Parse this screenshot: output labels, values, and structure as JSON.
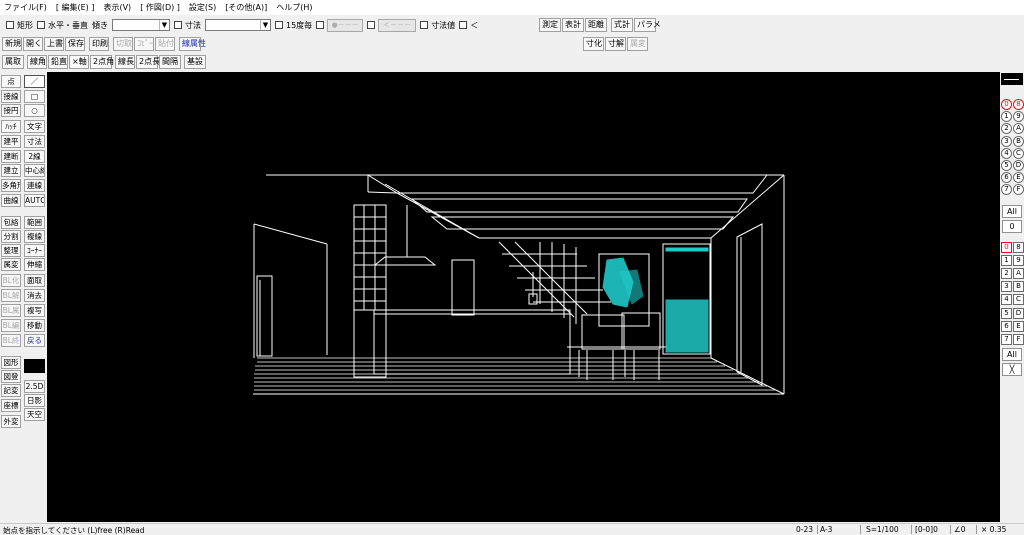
{
  "menu": [
    "ファイル(F)",
    "[ 編集(E) ]",
    "表示(V)",
    "[ 作図(D) ]",
    "設定(S)",
    "[その他(A)]",
    "ヘルプ(H)"
  ],
  "toolbar_top": {
    "rect_label": "矩形",
    "hv_label": "水平・垂直",
    "angle_label": "傾き",
    "angle_value": "",
    "dim_label": "寸法",
    "dim_value": "",
    "deg15_label": "15度毎",
    "btn_dot": "●－－－",
    "btn_arrow": "＜－－－",
    "dimval_label": "寸法値",
    "lt_label": "＜"
  },
  "toolbar_file": [
    "新規",
    "開く",
    "上書",
    "保存",
    "印刷",
    "切取",
    "ｺﾋﾟｰ",
    "貼付",
    "線属性"
  ],
  "toolbar_edit": [
    "属取",
    "線角",
    "鉛直",
    "×軸",
    "2点角",
    "線長",
    "2点長",
    "間隔",
    "基設"
  ],
  "toolbar_right1": [
    "測定",
    "表計",
    "距離",
    "式計",
    "パラメ"
  ],
  "toolbar_right2": [
    "寸化",
    "寸解",
    "属変"
  ],
  "left_palette": {
    "col1": [
      "点",
      "接線",
      "接円",
      "ﾊｯﾁ",
      "建平",
      "建断",
      "建立",
      "多角形",
      "曲線",
      "包絡",
      "分割",
      "整理",
      "属変",
      "BL化",
      "BL解",
      "BL属",
      "BL編",
      "BL終",
      "図形",
      "図登",
      "記変",
      "座標",
      "外変"
    ],
    "col2": [
      "／",
      "□",
      "○",
      "文字",
      "寸法",
      "2線",
      "中心線",
      "連線",
      "AUTO",
      "範囲",
      "複線",
      "ｺｰﾅｰ",
      "伸縮",
      "面取",
      "消去",
      "複写",
      "移動",
      "戻る",
      "2.5D",
      "日影",
      "天空"
    ]
  },
  "right_panel": {
    "circle_buttons": [
      [
        "0",
        "8"
      ],
      [
        "1",
        "9"
      ],
      [
        "2",
        "A"
      ],
      [
        "3",
        "B"
      ],
      [
        "4",
        "C"
      ],
      [
        "5",
        "D"
      ],
      [
        "6",
        "E"
      ],
      [
        "7",
        "F"
      ]
    ],
    "all_label_1": "All",
    "zero_label": "0",
    "square_buttons": [
      [
        "0",
        "8"
      ],
      [
        "1",
        "9"
      ],
      [
        "2",
        "A"
      ],
      [
        "3",
        "B"
      ],
      [
        "4",
        "C"
      ],
      [
        "5",
        "D"
      ],
      [
        "6",
        "E"
      ],
      [
        "7",
        "F"
      ]
    ],
    "all_label_2": "All",
    "x_label": "╳"
  },
  "status": {
    "message": "始点を指示してください (L)free (R)Read",
    "layer": "0-23",
    "paper": "A-3",
    "scale": "S=1/100",
    "layer_group": "[0-0]0",
    "angle": "∠0",
    "zoom": "× 0.35"
  },
  "colors": {
    "canvas": "#000000",
    "lines": "#ffffff",
    "accent": "#20c8c8"
  }
}
